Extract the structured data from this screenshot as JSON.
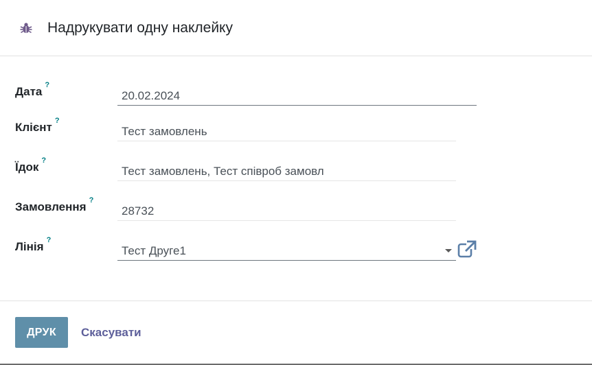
{
  "dialog": {
    "title": "Надрукувати одну наклейку",
    "icon": "bug-icon"
  },
  "form": {
    "help_mark": "?",
    "date": {
      "label": "Дата",
      "value": "20.02.2024"
    },
    "client": {
      "label": "Клієнт",
      "value": "Тест замовлень"
    },
    "eater": {
      "label": "Їдок",
      "value": "Тест замовлень, Тест співроб замовл"
    },
    "order": {
      "label": "Замовлення",
      "value": "28732"
    },
    "line": {
      "label": "Лінія",
      "value": "Тест Друге1"
    }
  },
  "footer": {
    "print_label": "ДРУК",
    "cancel_label": "Скасувати"
  },
  "colors": {
    "primary_button": "#5f8fa9",
    "link": "#5d5f9a",
    "help": "#017e84",
    "external_link_icon": "#5b7fa8"
  }
}
